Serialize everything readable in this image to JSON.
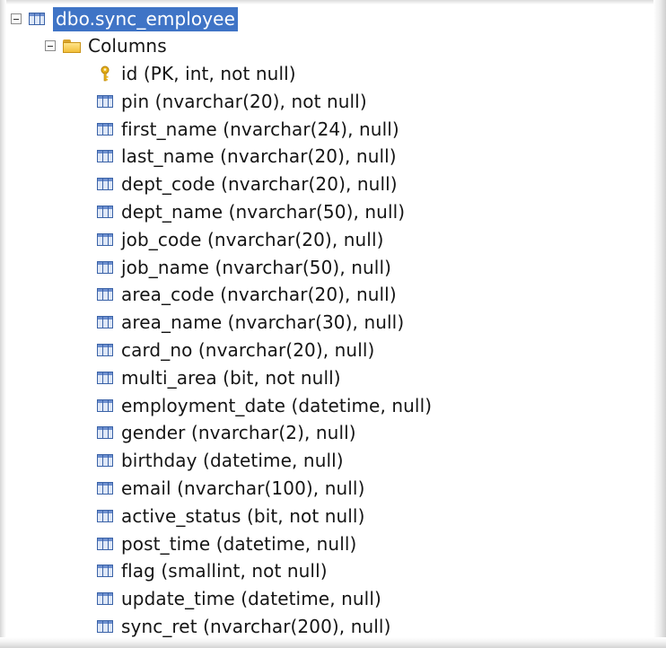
{
  "tree": {
    "table": {
      "label": "dbo.sync_employee",
      "icon": "table-icon",
      "selected": true
    },
    "folders": [
      {
        "label": "Columns",
        "icon": "folder-icon"
      }
    ],
    "columns": [
      {
        "label": "id (PK, int, not null)",
        "icon": "key-icon"
      },
      {
        "label": "pin (nvarchar(20), not null)",
        "icon": "column-icon"
      },
      {
        "label": "first_name (nvarchar(24), null)",
        "icon": "column-icon"
      },
      {
        "label": "last_name (nvarchar(20), null)",
        "icon": "column-icon"
      },
      {
        "label": "dept_code (nvarchar(20), null)",
        "icon": "column-icon"
      },
      {
        "label": "dept_name (nvarchar(50), null)",
        "icon": "column-icon"
      },
      {
        "label": "job_code (nvarchar(20), null)",
        "icon": "column-icon"
      },
      {
        "label": "job_name (nvarchar(50), null)",
        "icon": "column-icon"
      },
      {
        "label": "area_code (nvarchar(20), null)",
        "icon": "column-icon"
      },
      {
        "label": "area_name (nvarchar(30), null)",
        "icon": "column-icon"
      },
      {
        "label": "card_no (nvarchar(20), null)",
        "icon": "column-icon"
      },
      {
        "label": "multi_area (bit, not null)",
        "icon": "column-icon"
      },
      {
        "label": "employment_date (datetime, null)",
        "icon": "column-icon"
      },
      {
        "label": "gender (nvarchar(2), null)",
        "icon": "column-icon"
      },
      {
        "label": "birthday (datetime, null)",
        "icon": "column-icon"
      },
      {
        "label": "email (nvarchar(100), null)",
        "icon": "column-icon"
      },
      {
        "label": "active_status (bit, not null)",
        "icon": "column-icon"
      },
      {
        "label": "post_time (datetime, null)",
        "icon": "column-icon"
      },
      {
        "label": "flag (smallint, not null)",
        "icon": "column-icon"
      },
      {
        "label": "update_time (datetime, null)",
        "icon": "column-icon"
      },
      {
        "label": "sync_ret (nvarchar(200), null)",
        "icon": "column-icon"
      }
    ]
  },
  "colors": {
    "selection": "#3f74c6",
    "text": "#151515",
    "column_icon": "#3b63a8",
    "folder": "#f2bf3a",
    "key": "#e8b21a"
  }
}
